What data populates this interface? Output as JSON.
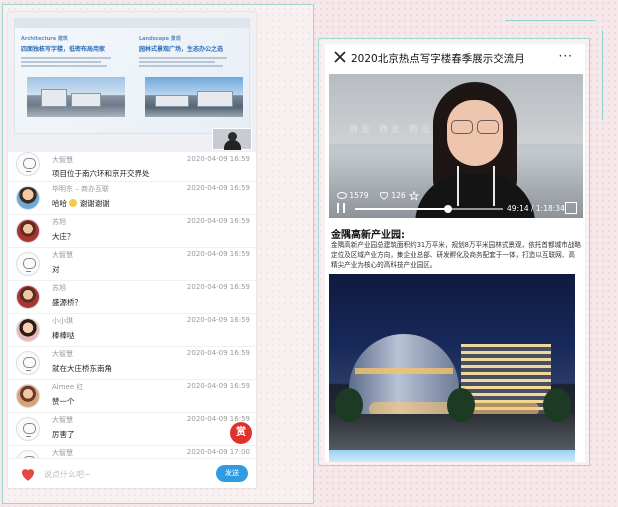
{
  "left_phone": {
    "slide": {
      "col1_sub": "Architecture 建筑",
      "col1_heading": "四面独栋写字楼，低密布局用家",
      "col2_sub": "Landscape 景观",
      "col2_heading": "园林式景观广场，生态办公之选"
    },
    "chat": [
      {
        "name": "大智慧",
        "time": "2020-04-09 16:59",
        "message": "项目位于南六环和京开交界处",
        "avatar": "robot"
      },
      {
        "name": "毕明东 – 商办互联",
        "time": "2020-04-09 16:59",
        "message": "哈哈",
        "message_suffix": "谢谢谢谢",
        "avatar": "photo-a"
      },
      {
        "name": "苏旭",
        "time": "2020-04-09 16:59",
        "message": "大庄？",
        "avatar": "photo-b"
      },
      {
        "name": "大智慧",
        "time": "2020-04-09 16:59",
        "message": "对",
        "avatar": "robot"
      },
      {
        "name": "苏旭",
        "time": "2020-04-09 16:59",
        "message": "盛源桥？",
        "avatar": "photo-b"
      },
      {
        "name": "小小琪",
        "time": "2020-04-09 16:59",
        "message": "棒棒哒",
        "avatar": "photo-c"
      },
      {
        "name": "大智慧",
        "time": "2020-04-09 16:59",
        "message": "就在大庄桥东南角",
        "avatar": "robot"
      },
      {
        "name": "Aimee 红",
        "time": "2020-04-09 16:59",
        "message": "赞一个",
        "avatar": "photo-d"
      },
      {
        "name": "大智慧",
        "time": "2020-04-09 16:59",
        "message": "厉害了",
        "avatar": "robot"
      },
      {
        "name": "大智慧",
        "time": "2020-04-09 17:00",
        "message": "",
        "avatar": "robot"
      }
    ],
    "reward_label": "赏",
    "input_placeholder": "说点什么吧~",
    "send_label": "发送",
    "colors": {
      "accent": "#2f9be3",
      "reward": "#e0312c",
      "heart": "#e8453c"
    }
  },
  "right_phone": {
    "title": "2020北京热点写字楼春季展示交流月",
    "more_label": "···",
    "video": {
      "wall_text": "商业 商业 商业",
      "views": "1579",
      "likes": "126",
      "current_time": "49:14",
      "total_time": "1:18:34",
      "progress": 0.626
    },
    "article_title": "金隅高新产业园:",
    "article_body": "金隅高新产业园总建筑面积约31万平米，规划8万平米园林式景观，依托首都城市战略定位及区域产业方向，集企业总部、研发孵化及商务配套于一体，打造以互联网、高精尖产业为核心的高科技产业园区。"
  }
}
